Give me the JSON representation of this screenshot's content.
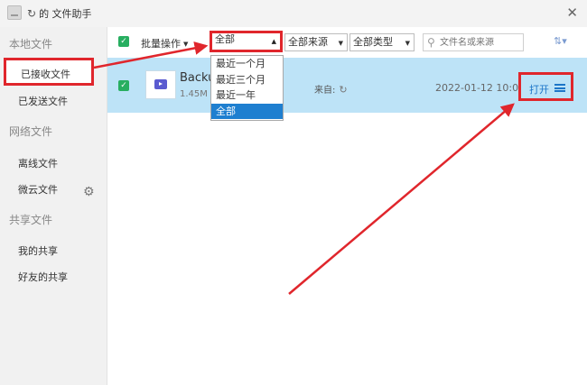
{
  "window": {
    "title": "的 文件助手",
    "close_glyph": "✕"
  },
  "sidebar": {
    "local_heading": "本地文件",
    "received": "已接收文件",
    "sent": "已发送文件",
    "network_heading": "网络文件",
    "offline": "离线文件",
    "weiyun": "微云文件",
    "shared_heading": "共享文件",
    "my_share": "我的共享",
    "friends_share": "好友的共享"
  },
  "toolbar": {
    "batch_label": "批量操作",
    "time_filter": "全部",
    "source_filter": "全部来源",
    "type_filter": "全部类型",
    "search_placeholder": "文件名或来源",
    "sort_glyph": "⇅▾"
  },
  "dropdown": {
    "options": [
      "最近一个月",
      "最近三个月",
      "最近一年",
      "全部"
    ],
    "selected": "全部"
  },
  "file": {
    "name": "Backu        t",
    "size": "1.45M",
    "from_label": "来自:",
    "date": "2022-01-12 10:09",
    "open_label": "打开"
  },
  "colors": {
    "highlight": "#e0262c",
    "row_bg": "#bde3f7",
    "accent": "#1e7fd0"
  }
}
